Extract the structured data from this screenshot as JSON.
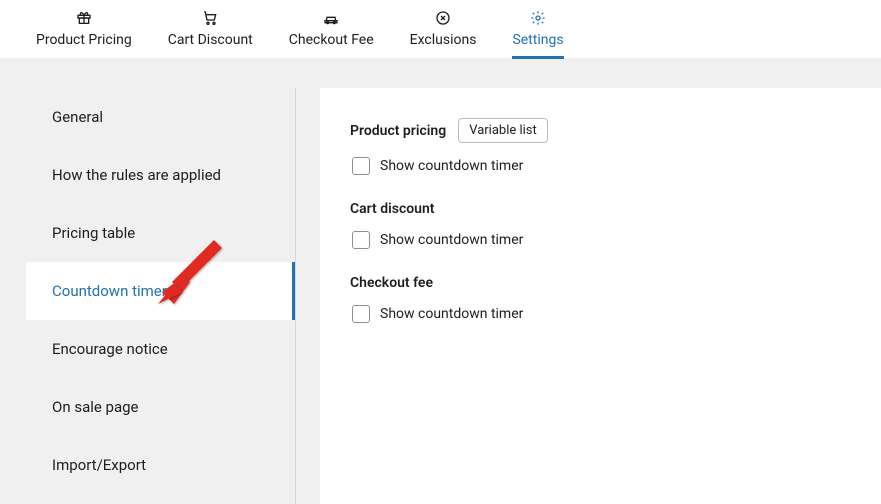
{
  "topTabs": {
    "productPricing": "Product Pricing",
    "cartDiscount": "Cart Discount",
    "checkoutFee": "Checkout Fee",
    "exclusions": "Exclusions",
    "settings": "Settings"
  },
  "sidebar": {
    "general": "General",
    "howRules": "How the rules are applied",
    "pricingTable": "Pricing table",
    "countdownTimer": "Countdown timer",
    "encourageNotice": "Encourage notice",
    "onSalePage": "On sale page",
    "importExport": "Import/Export"
  },
  "content": {
    "productPricing": {
      "title": "Product pricing",
      "pill": "Variable list",
      "chkLabel": "Show countdown timer"
    },
    "cartDiscount": {
      "title": "Cart discount",
      "chkLabel": "Show countdown timer"
    },
    "checkoutFee": {
      "title": "Checkout fee",
      "chkLabel": "Show countdown timer"
    }
  }
}
